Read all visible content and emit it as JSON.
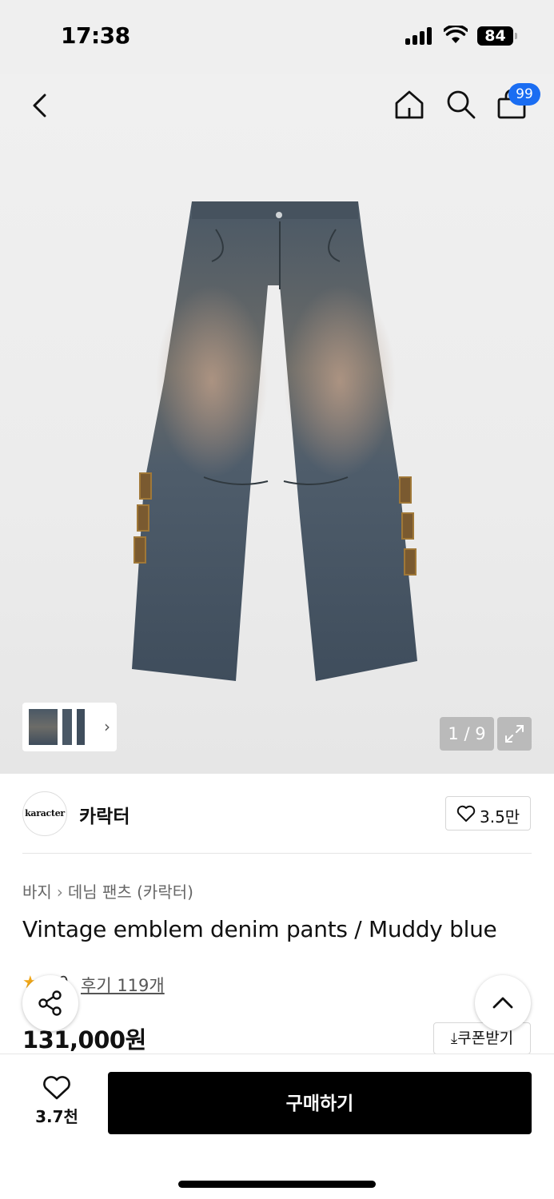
{
  "status_bar": {
    "time": "17:38",
    "battery": "84"
  },
  "header": {
    "cart_badge": "99"
  },
  "gallery": {
    "page_counter": "1 / 9"
  },
  "brand": {
    "logo_text": "karacter",
    "name": "카락터",
    "like_count": "3.5만"
  },
  "breadcrumb": {
    "category": "바지",
    "subcategory": "데님 팬츠 (카락터)"
  },
  "product": {
    "title": "Vintage emblem denim pants / Muddy blue",
    "rating": "4.9",
    "review_link": "후기 119개",
    "price": "131,000원",
    "coupon_label": "쿠폰받기"
  },
  "bottom_bar": {
    "wish_count": "3.7천",
    "buy_label": "구매하기"
  },
  "colors": {
    "badge": "#1a6df2",
    "star": "#f2a818",
    "buy_button": "#000000"
  },
  "icons": [
    "back-icon",
    "home-icon",
    "search-icon",
    "cart-icon",
    "chevron-right-icon",
    "expand-icon",
    "heart-icon",
    "star-icon",
    "share-icon",
    "chevron-up-icon",
    "download-icon"
  ]
}
